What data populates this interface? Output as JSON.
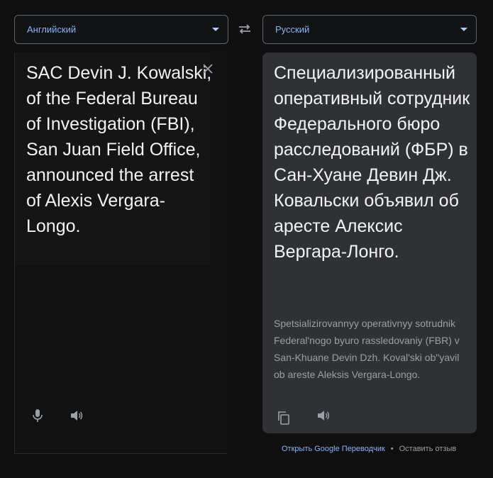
{
  "source_language": {
    "label": "Английский",
    "icon": "chevron-down-icon"
  },
  "target_language": {
    "label": "Русский",
    "icon": "chevron-down-icon"
  },
  "swap_icon": "swap-languages-icon",
  "source": {
    "text": "SAC Devin J. Kowalski, of the Federal Bureau of Investigation (FBI), San Juan Field Office, announced the arrest of Alexis Vergara-Longo.",
    "clear_icon": "close-icon",
    "mic_icon": "microphone-icon",
    "speaker_icon": "speaker-icon"
  },
  "target": {
    "text": "Специализированный оперативный сотрудник Федерального бюро расследований (ФБР) в Сан-Хуане Девин Дж. Ковальски объявил об аресте Алексис Вергара-Лонго.",
    "transliteration": "Spetsializirovannyy operativnyy sotrudnik Federal'nogo byuro rassledovaniy (FBR) v San-Khuane Devin Dzh. Koval'ski ob\"yavil ob areste Aleksis Vergara-Longo.",
    "copy_icon": "copy-icon",
    "speaker_icon": "speaker-icon"
  },
  "footer": {
    "open_link": "Открыть Google Переводчик",
    "separator": "•",
    "feedback": "Оставить отзыв"
  },
  "colors": {
    "accent": "#8ab4f8",
    "panel": "#303134",
    "background": "#0f0f10"
  }
}
